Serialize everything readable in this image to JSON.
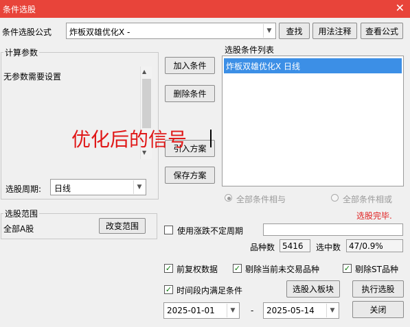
{
  "title": "条件选股",
  "formula": {
    "label": "条件选股公式",
    "value": "炸板双雄优化X  -",
    "find_button": "查找",
    "usage_button": "用法注释",
    "view_button": "查看公式"
  },
  "params": {
    "group_title": "计算参数",
    "text": "无参数需要设置",
    "period_label": "选股周期:",
    "period_value": "日线"
  },
  "condition_buttons": {
    "add": "加入条件",
    "delete": "删除条件",
    "import": "引入方案",
    "save": "保存方案"
  },
  "overlay_text": "优化后的信号",
  "conditions": {
    "title": "选股条件列表",
    "items": [
      "炸板双雄优化X  日线"
    ],
    "and_label": "全部条件相与",
    "or_label": "全部条件相或"
  },
  "range": {
    "group_title": "选股范围",
    "value": "全部A股",
    "change_button": "改变范围"
  },
  "status": "选股完毕.",
  "variable_period_label": "使用涨跌不定周期",
  "stats": {
    "count_label": "品种数",
    "count_value": "5416",
    "selected_label": "选中数",
    "selected_value": "47/0.9%"
  },
  "options": {
    "fq": "前复权数据",
    "remove_untraded": "剔除当前未交易品种",
    "remove_st": "剔除ST品种",
    "time_range": "时间段内满足条件"
  },
  "dates": {
    "start": "2025-01-01",
    "sep": "-",
    "end": "2025-05-14"
  },
  "actions": {
    "to_block": "选股入板块",
    "execute": "执行选股",
    "close": "关闭"
  },
  "colors": {
    "title_bar": "#e8443a",
    "selection": "#3c8fe6",
    "status": "#e02020",
    "overlay": "#e01818"
  },
  "icons": {
    "close": "close-icon",
    "dropdown": "chevron-down-icon",
    "check": "check-icon"
  }
}
